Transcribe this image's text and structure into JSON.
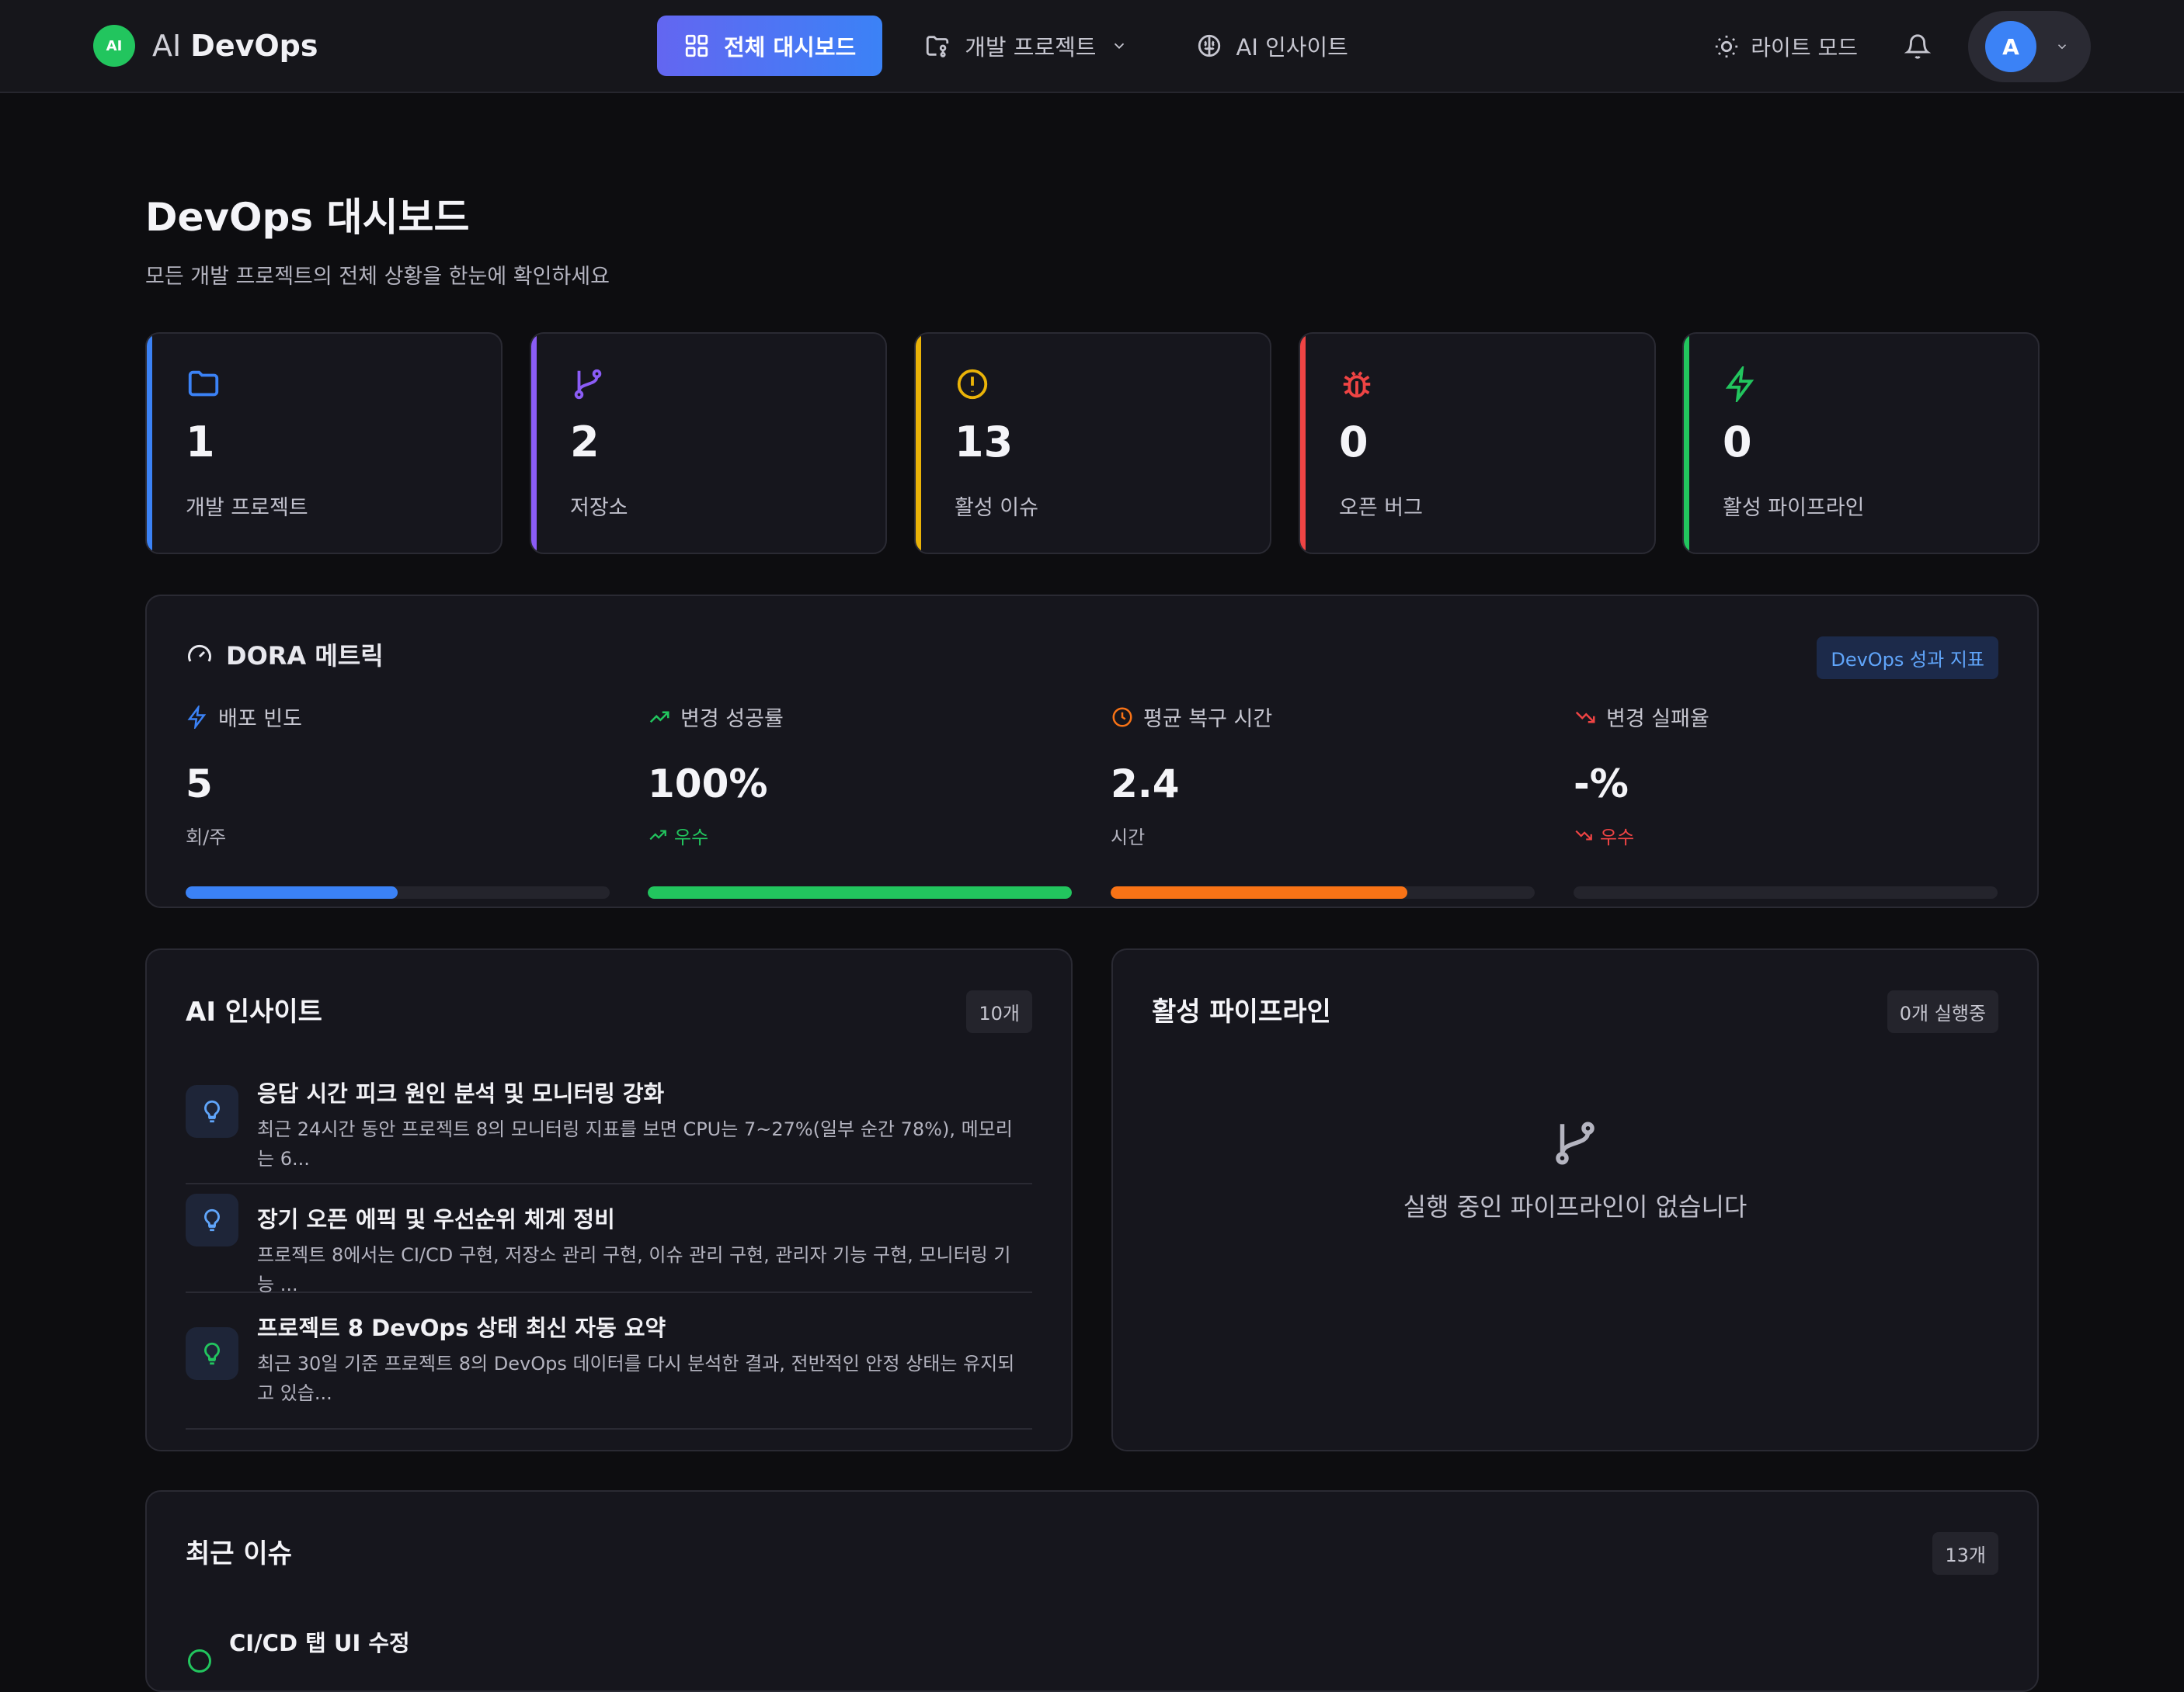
{
  "app": {
    "logo_badge": "AI",
    "name_prefix": "AI",
    "name_main": "DevOps"
  },
  "nav": {
    "dashboard": "전체 대시보드",
    "projects": "개발 프로젝트",
    "insights": "AI 인사이트"
  },
  "toolbar": {
    "theme_toggle": "라이트 모드",
    "avatar_letter": "A"
  },
  "page": {
    "title": "DevOps 대시보드",
    "subtitle": "모든 개발 프로젝트의 전체 상황을 한눈에 확인하세요"
  },
  "stats": [
    {
      "value": "1",
      "label": "개발 프로젝트",
      "color": "#3b82f6",
      "icon": "folder-icon"
    },
    {
      "value": "2",
      "label": "저장소",
      "color": "#8b5cf6",
      "icon": "git-branch-icon"
    },
    {
      "value": "13",
      "label": "활성 이슈",
      "color": "#eab308",
      "icon": "alert-circle-icon"
    },
    {
      "value": "0",
      "label": "오픈 버그",
      "color": "#ef4444",
      "icon": "bug-icon"
    },
    {
      "value": "0",
      "label": "활성 파이프라인",
      "color": "#22c55e",
      "icon": "zap-icon"
    }
  ],
  "dora": {
    "title": "DORA 메트릭",
    "tag": "DevOps 성과 지표",
    "metrics": [
      {
        "label": "배포 빈도",
        "value": "5",
        "sub": "회/주",
        "progress": 0.5,
        "color": "#3b82f6"
      },
      {
        "label": "변경 성공률",
        "value": "100%",
        "sub": "우수",
        "progress": 1.0,
        "color": "#22c55e"
      },
      {
        "label": "평균 복구 시간",
        "value": "2.4",
        "sub": "시간",
        "progress": 0.7,
        "color": "#f97316"
      },
      {
        "label": "변경 실패율",
        "value": "-%",
        "sub": "우수",
        "progress": 0,
        "color": "#ef4444"
      }
    ]
  },
  "insights": {
    "title": "AI 인사이트",
    "count": "10개",
    "items": [
      {
        "title": "응답 시간 피크 원인 분석 및 모니터링 강화",
        "desc": "최근 24시간 동안 프로젝트 8의 모니터링 지표를 보면 CPU는 7~27%(일부 순간 78%), 메모리는 6..."
      },
      {
        "title": "장기 오픈 에픽 및 우선순위 체계 정비",
        "desc": "프로젝트 8에서는 CI/CD 구현, 저장소 관리 구현, 이슈 관리 구현, 관리자 기능 구현, 모니터링 기능 ..."
      },
      {
        "title": "프로젝트 8 DevOps 상태 최신 자동 요약",
        "desc": "최근 30일 기준 프로젝트 8의 DevOps 데이터를 다시 분석한 결과, 전반적인 안정 상태는 유지되고 있습..."
      }
    ]
  },
  "pipelines": {
    "title": "활성 파이프라인",
    "count": "0개 실행중",
    "empty": "실행 중인 파이프라인이 없습니다"
  },
  "recent": {
    "title": "최근 이슈",
    "count": "13개",
    "first_issue": "CI/CD 탭 UI 수정"
  }
}
